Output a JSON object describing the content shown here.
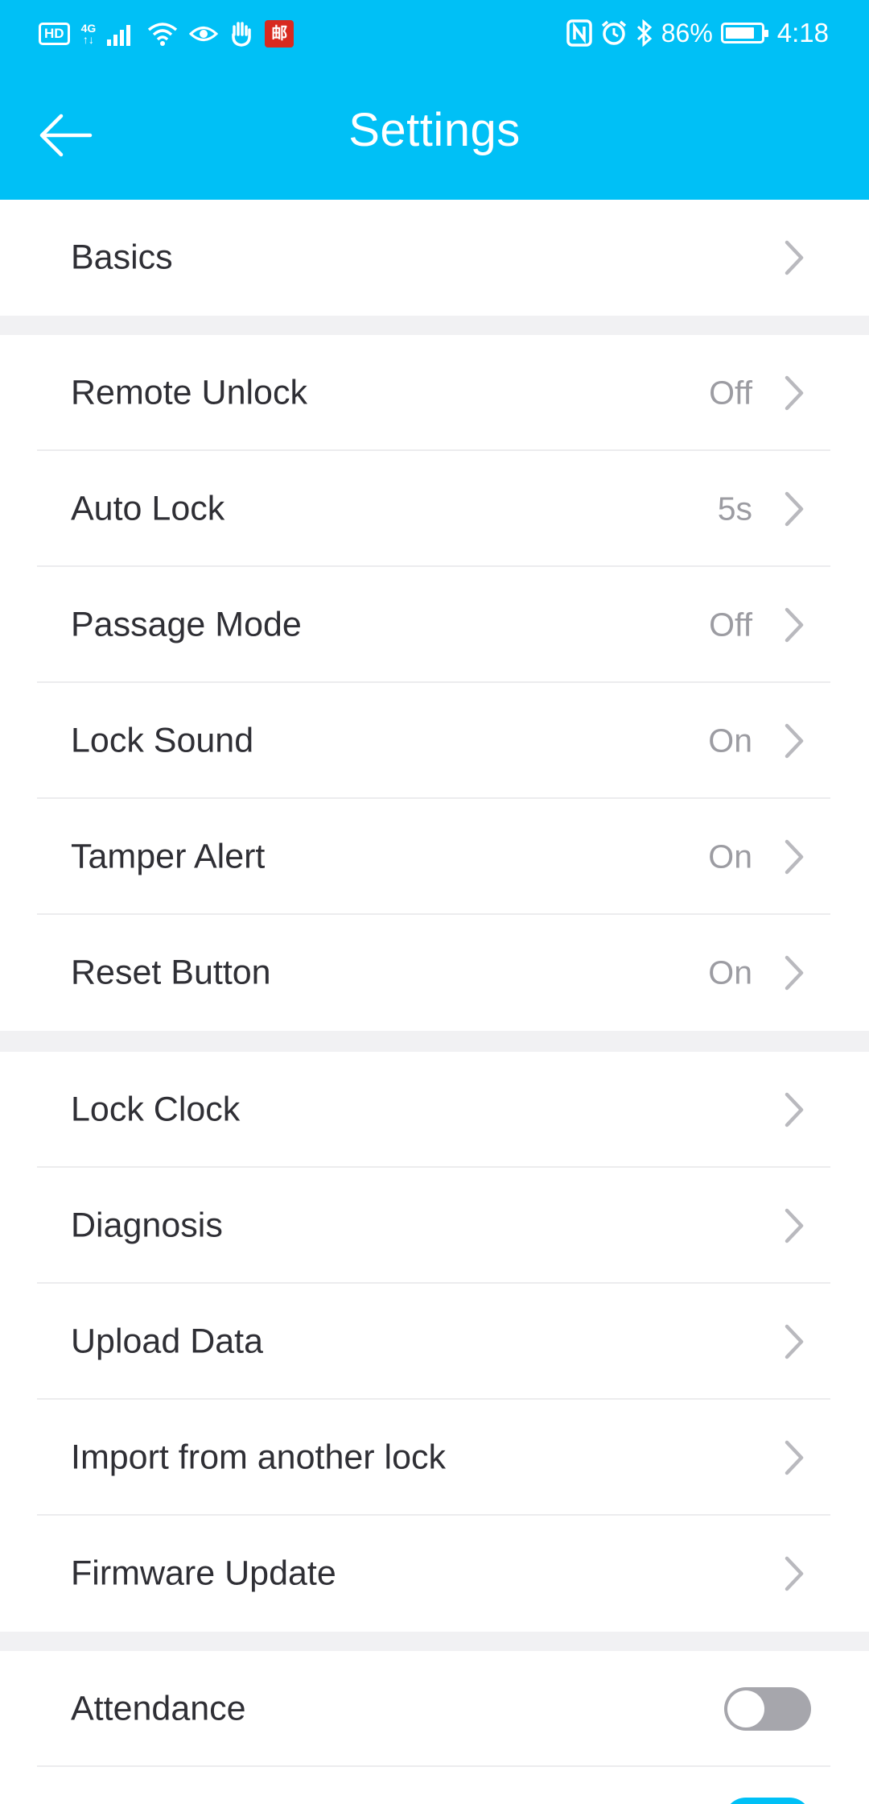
{
  "status_bar": {
    "hd_label": "HD",
    "network_label": "4G",
    "network_sub": "↑↓",
    "badge_char": "邮",
    "battery_pct": "86%",
    "battery_fraction": 0.86,
    "time": "4:18"
  },
  "header": {
    "title": "Settings",
    "color": "#00c0f6"
  },
  "sections": [
    [
      {
        "label": "Basics",
        "value": ""
      }
    ],
    [
      {
        "label": "Remote Unlock",
        "value": "Off"
      },
      {
        "label": "Auto Lock",
        "value": "5s"
      },
      {
        "label": "Passage Mode",
        "value": "Off"
      },
      {
        "label": "Lock Sound",
        "value": "On"
      },
      {
        "label": "Tamper Alert",
        "value": "On"
      },
      {
        "label": "Reset Button",
        "value": "On"
      }
    ],
    [
      {
        "label": "Lock Clock",
        "value": ""
      },
      {
        "label": "Diagnosis",
        "value": ""
      },
      {
        "label": "Upload Data",
        "value": ""
      },
      {
        "label": "Import from another lock",
        "value": ""
      },
      {
        "label": "Firmware Update",
        "value": ""
      }
    ],
    [
      {
        "label": "Attendance",
        "toggle": false
      }
    ]
  ],
  "colors": {
    "accent": "#00c0f6",
    "toggle_off": "#a6a6ac",
    "background": "#f1f1f3"
  }
}
